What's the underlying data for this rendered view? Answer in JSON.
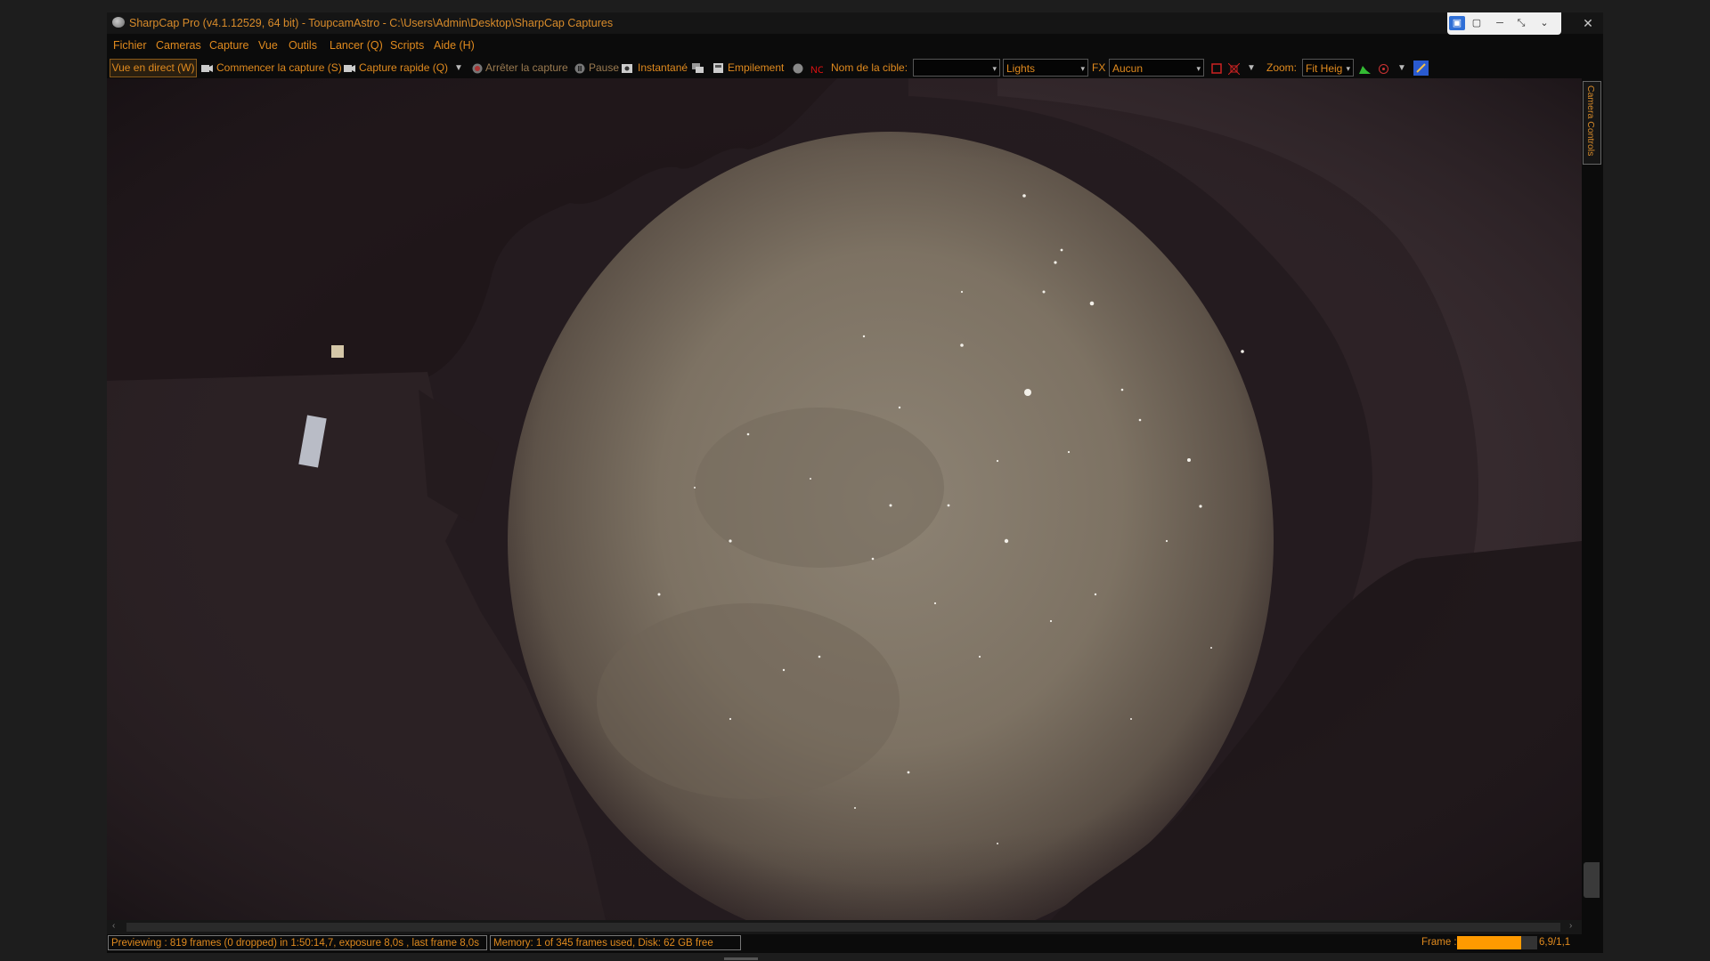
{
  "window": {
    "title": "SharpCap Pro (v4.1.12529, 64 bit) - ToupcamAstro - C:\\Users\\Admin\\Desktop\\SharpCap Captures",
    "controls": {
      "minimize": "─",
      "restore": "❐",
      "close": "✕"
    }
  },
  "remote_bar": {
    "icons": [
      "monitor-icon",
      "chat-icon",
      "minimize-icon",
      "collapse-icon",
      "chevron-down-icon"
    ]
  },
  "menu": {
    "items": [
      {
        "label": "Fichier"
      },
      {
        "label": "Cameras"
      },
      {
        "label": "Capture"
      },
      {
        "label": "Vue"
      },
      {
        "label": "Outils"
      },
      {
        "label": "Lancer (Q)"
      },
      {
        "label": "Scripts"
      },
      {
        "label": "Aide (H)"
      }
    ]
  },
  "toolbar": {
    "live_view": "Vue en direct (W)",
    "start_capture": "Commencer la capture (S)",
    "quick_capture": "Capture rapide (Q)",
    "stop_capture": "Arrêter la capture",
    "pause": "Pause",
    "snapshot": "Instantané",
    "stacking": "Empilement",
    "target_label": "Nom de la cible:",
    "target_value": "",
    "frame_type": "Lights",
    "fx_label": "FX",
    "fx_value": "Aucun",
    "zoom_label": "Zoom:",
    "zoom_value": "Fit Heig"
  },
  "side_panel": {
    "camera_controls": "Camera Controls"
  },
  "status": {
    "preview": "Previewing : 819 frames (0 dropped) in 1:50:14,7, exposure 8,0s , last frame 8,0s",
    "memory": "Memory: 1 of 345 frames used, Disk: 62 GB free",
    "frame_label": "Frame :",
    "frame_value": "6,9/1,1",
    "frame_progress": 0.8
  },
  "colors": {
    "accent": "#e08a1e",
    "background": "#0b0b0b",
    "frame_bar": "#ff9a00"
  }
}
